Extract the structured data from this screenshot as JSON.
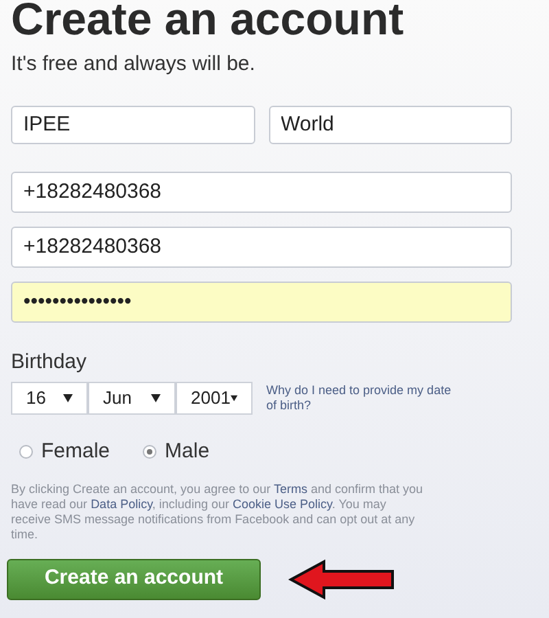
{
  "title": "Create an account",
  "subtitle": "It's free and always will be.",
  "name_fields": [
    {
      "value": "IPEE"
    },
    {
      "value": "World"
    }
  ],
  "fields": [
    {
      "value": "+18282480368",
      "kind": "text"
    },
    {
      "value": "+18282480368",
      "kind": "text"
    },
    {
      "value": "•••••••••••••••",
      "kind": "password"
    }
  ],
  "birthday": {
    "label": "Birthday",
    "selects": [
      {
        "value": "16"
      },
      {
        "value": "Jun"
      },
      {
        "value": "2001"
      }
    ],
    "help_link": "Why do I need to provide my date of birth?"
  },
  "gender": [
    {
      "label": "Female",
      "selected": false
    },
    {
      "label": "Male",
      "selected": true
    }
  ],
  "terms": [
    {
      "kind": "text",
      "text": "By clicking Create an account, you agree to our"
    },
    {
      "kind": "link",
      "text": "Terms"
    },
    {
      "kind": "text",
      "text": "and confirm that you have read our"
    },
    {
      "kind": "link",
      "text": "Data Policy"
    },
    {
      "kind": "text",
      "text": ", including our"
    },
    {
      "kind": "link",
      "text": "Cookie Use Policy"
    },
    {
      "kind": "text",
      "text": ". You may receive SMS message notifications from Facebook and can opt out at any time."
    }
  ],
  "submit": "Create an account"
}
